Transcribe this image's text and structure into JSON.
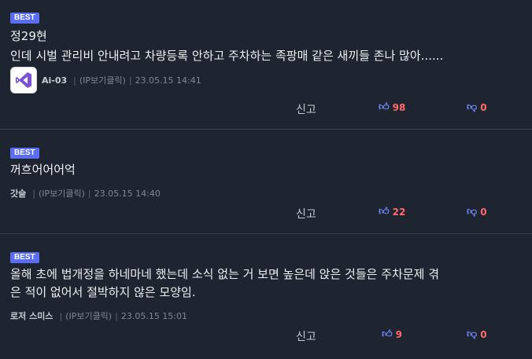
{
  "comments": [
    {
      "badge": "BEST",
      "title": "정29현",
      "text": "인데 시벌 관리비 안내려고 차량등록 안하고 주차하는 족팡매 같은 새끼들 존나 많아......",
      "author": "Ai-03",
      "ip_label": "(IP보기클릭)",
      "date": "23.05.15 14:41",
      "report_label": "신고",
      "up_count": "98",
      "down_count": "0",
      "has_avatar": true
    },
    {
      "badge": "BEST",
      "text": "꺼흐어어어억",
      "author": "갓슬",
      "ip_label": "(IP보기클릭)",
      "date": "23.05.15 14:40",
      "report_label": "신고",
      "up_count": "22",
      "down_count": "0"
    },
    {
      "badge": "BEST",
      "text": "올해 초에 법개정을 하네마네 했는데 소식 없는 거 보면 높은데 앉은 것들은 주차문제 겪\n은 적이 없어서 절박하지 않은 모양임.",
      "author": "로저 스미스",
      "ip_label": "(IP보기클릭)",
      "date": "23.05.15 15:01",
      "report_label": "신고",
      "up_count": "9",
      "down_count": "0"
    }
  ],
  "colors": {
    "background": "#1e2530",
    "badge": "#5b6df2",
    "vote_icon": "#6d86f2",
    "vote_count": "#ff6b6b"
  },
  "icons": {
    "avatar": "visual-studio-logo",
    "up": "thumbs-up-icon",
    "down": "thumbs-down-icon"
  }
}
